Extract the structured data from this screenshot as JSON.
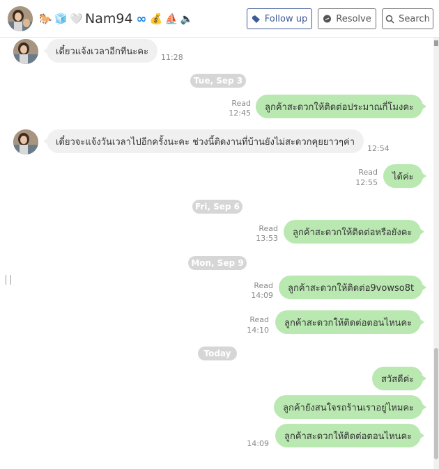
{
  "header": {
    "contact_name": "Nam94",
    "emojis": [
      "🐎",
      "🧊",
      "🤍"
    ],
    "emojis_after": [
      "💰",
      "⛵",
      "🔈"
    ],
    "buttons": {
      "follow_up": "Follow up",
      "resolve": "Resolve",
      "search": "Search"
    }
  },
  "messages": [
    {
      "dir": "in",
      "text": "เดี๋ยวแจ้งเวลาอีกทีนะคะ",
      "time": "11:28"
    },
    {
      "dir": "date",
      "text": "Tue, Sep 3"
    },
    {
      "dir": "out",
      "text": "ลูกค้าสะดวกให้ติดต่อประมาณกี่โมงคะ",
      "status": "Read",
      "time": "12:45"
    },
    {
      "dir": "in",
      "text": "เดี๋ยวจะแจ้งวันเวลาไปอีกครั้งนะคะ ช่วงนี้ติดงานที่บ้านยังไม่สะดวกคุยยาวๆค่า",
      "time": "12:54"
    },
    {
      "dir": "out",
      "text": "ได้ค่ะ",
      "status": "Read",
      "time": "12:55"
    },
    {
      "dir": "date",
      "text": "Fri, Sep 6"
    },
    {
      "dir": "out",
      "text": "ลูกค้าสะดวกให้ติดต่อหรือยังคะ",
      "status": "Read",
      "time": "13:53"
    },
    {
      "dir": "date",
      "text": "Mon, Sep 9"
    },
    {
      "dir": "out",
      "text": "ลูกค้าสะดวกให้ติดต่อ9vowso8t",
      "status": "Read",
      "time": "14:09"
    },
    {
      "dir": "out",
      "text": "ลูกค้าสะดวกให้ติดต่อตอนไหนคะ",
      "status": "Read",
      "time": "14:10"
    },
    {
      "dir": "date",
      "text": "Today"
    },
    {
      "dir": "out",
      "text": "สวัสดีค่ะ"
    },
    {
      "dir": "out",
      "text": "ลูกค้ายังสนใจรถร้านเราอยู่ไหมคะ"
    },
    {
      "dir": "out",
      "text": "ลูกค้าสะดวกให้ติดต่อตอนไหนคะ",
      "time": "14:09"
    }
  ]
}
